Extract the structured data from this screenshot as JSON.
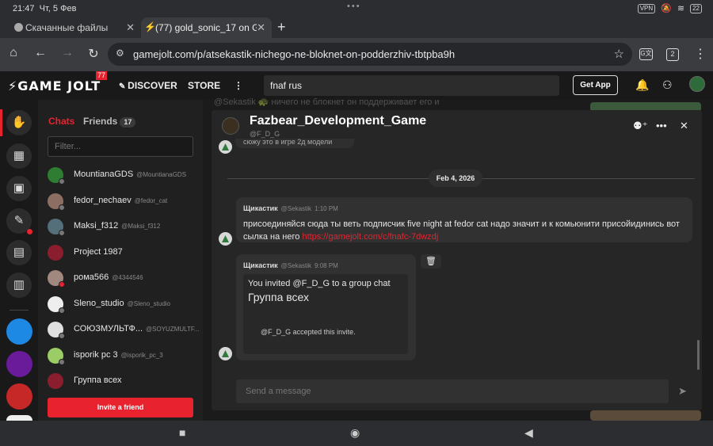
{
  "status_bar": {
    "time": "21:47",
    "date": "Чт, 5 Фев",
    "dots": "•••",
    "vpn": "VPN",
    "battery": "22"
  },
  "browser": {
    "tabs": [
      {
        "title": "Скачанные файлы",
        "close": "✕"
      },
      {
        "title": "(77) gold_sonic_17 on Game",
        "close": "✕"
      }
    ],
    "new_tab": "+",
    "url": "gamejolt.com/p/atsekastik-nichego-ne-bloknet-on-podderzhiv-tbtpba9h",
    "tab_count": "2"
  },
  "site": {
    "logo": "GAME JOLT",
    "logo_badge": "77",
    "nav": {
      "discover": "DISCOVER",
      "store": "STORE"
    },
    "search_value": "fnaf rus",
    "get_app": "Get App",
    "background_text": "@Sekastik 🐢 ничего не блокнет он поддерживает его и"
  },
  "sidebar": {
    "tab_chats": "Chats",
    "tab_friends": "Friends",
    "friends_count": "17",
    "filter_placeholder": "Filter...",
    "friends": [
      {
        "name": "MountianaGDS",
        "username": "@MountianaGDS",
        "avatar": "#2e7d32",
        "status": "#777"
      },
      {
        "name": "fedor_nechaev",
        "username": "@fedor_cat",
        "avatar": "#8d6e63",
        "status": "#777"
      },
      {
        "name": "Maksi_f312",
        "username": "@Maksi_f312",
        "avatar": "#546e7a",
        "status": "#777"
      },
      {
        "name": "Project 1987",
        "username": "",
        "avatar": "#8b1e2e",
        "status": ""
      },
      {
        "name": "рома566",
        "username": "@4344546",
        "avatar": "#a1887f",
        "status": "#e8222e"
      },
      {
        "name": "Sleno_studio",
        "username": "@Sleno_studio",
        "avatar": "#eeeeee",
        "status": "#777"
      },
      {
        "name": "СОЮЗМУЛЬТФ...",
        "username": "@SOYUZMULTF...",
        "avatar": "#e0e0e0",
        "status": "#777"
      },
      {
        "name": "isporik pc 3",
        "username": "@isporik_pc_3",
        "avatar": "#9ccc65",
        "status": "#777"
      },
      {
        "name": "Группа всех",
        "username": "",
        "avatar": "#8b1e2e",
        "status": ""
      }
    ],
    "invite_button": "Invite a friend"
  },
  "chat": {
    "title": "Fazbear_Development_Game",
    "subtitle": "@F_D_G",
    "previous_snippet": "сюжу это в игре 2д модели",
    "date_divider": "Feb 4, 2026",
    "messages": [
      {
        "author": "Щикастик",
        "username": "@Sekastik",
        "time": "1:10 PM",
        "text": "присоединяйся сюда ты веть подписчик five night at fedor cat надо значит и к комьюнити присойидинись вот сылка на него",
        "link": "https://gamejolt.com/c/fnafc-7dwzdj"
      },
      {
        "author": "Щикастик",
        "username": "@Sekastik",
        "time": "9:08 PM",
        "invite_line": "You invited @F_D_G to a group chat",
        "group_name": "Группа всех",
        "accepted": "@F_D_G accepted this invite."
      }
    ],
    "composer_placeholder": "Send a message"
  }
}
